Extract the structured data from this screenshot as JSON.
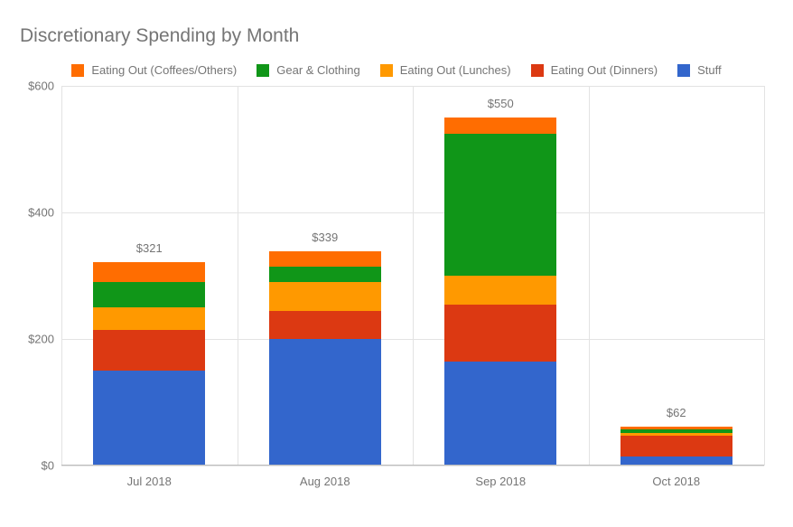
{
  "chart_data": {
    "type": "bar",
    "stacked": true,
    "title": "Discretionary Spending by Month",
    "xlabel": "",
    "ylabel": "",
    "ylim": [
      0,
      600
    ],
    "yticks": [
      "$0",
      "$200",
      "$400",
      "$600"
    ],
    "categories": [
      "Jul 2018",
      "Aug 2018",
      "Sep 2018",
      "Oct 2018"
    ],
    "totals_labels": [
      "$321",
      "$339",
      "$550",
      "$62"
    ],
    "totals": [
      321,
      339,
      550,
      62
    ],
    "series": [
      {
        "name": "Stuff",
        "color": "#3366cc",
        "values": [
          150,
          200,
          165,
          15
        ]
      },
      {
        "name": "Eating Out (Dinners)",
        "color": "#dc3912",
        "values": [
          65,
          45,
          90,
          32
        ]
      },
      {
        "name": "Eating Out (Lunches)",
        "color": "#ff9900",
        "values": [
          35,
          45,
          45,
          5
        ]
      },
      {
        "name": "Gear & Clothing",
        "color": "#109618",
        "values": [
          40,
          25,
          225,
          5
        ]
      },
      {
        "name": "Eating Out (Coffees/Others)",
        "color": "#ff6d01",
        "values": [
          31,
          24,
          25,
          5
        ]
      }
    ],
    "legend_order": [
      "Eating Out (Coffees/Others)",
      "Gear & Clothing",
      "Eating Out (Lunches)",
      "Eating Out (Dinners)",
      "Stuff"
    ],
    "grid": {
      "x": true,
      "y": true
    },
    "legend_position": "top"
  }
}
